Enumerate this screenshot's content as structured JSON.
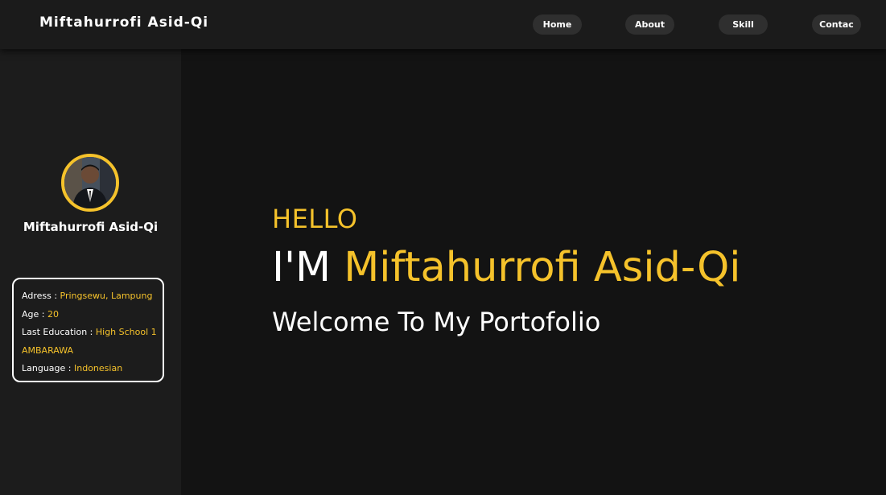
{
  "header": {
    "brand": "Miftahurrofi Asid-Qi",
    "nav": [
      {
        "label": "Home"
      },
      {
        "label": "About"
      },
      {
        "label": "Skill"
      },
      {
        "label": "Contac"
      }
    ]
  },
  "sidebar": {
    "name": "Miftahurrofi Asid-Qi",
    "info": {
      "address_label": "Adress : ",
      "address_value": "Pringsewu, Lampung",
      "age_label": "Age : ",
      "age_value": "20",
      "education_label": "Last Education : ",
      "education_value": "High School 1 AMBARAWA",
      "language_label": "Language : ",
      "language_value": "Indonesian"
    }
  },
  "hero": {
    "greeting": "HELLO",
    "im": "I'M ",
    "name": "Miftahurrofi Asid-Qi",
    "tagline": "Welcome To My Portofolio"
  },
  "colors": {
    "accent": "#f5c22b",
    "background": "#131313",
    "sidebar": "#1c1c1c",
    "navbar": "#1b1b1b",
    "nav_button": "#2f2f2f"
  },
  "icons": {
    "avatar": "profile-photo"
  }
}
